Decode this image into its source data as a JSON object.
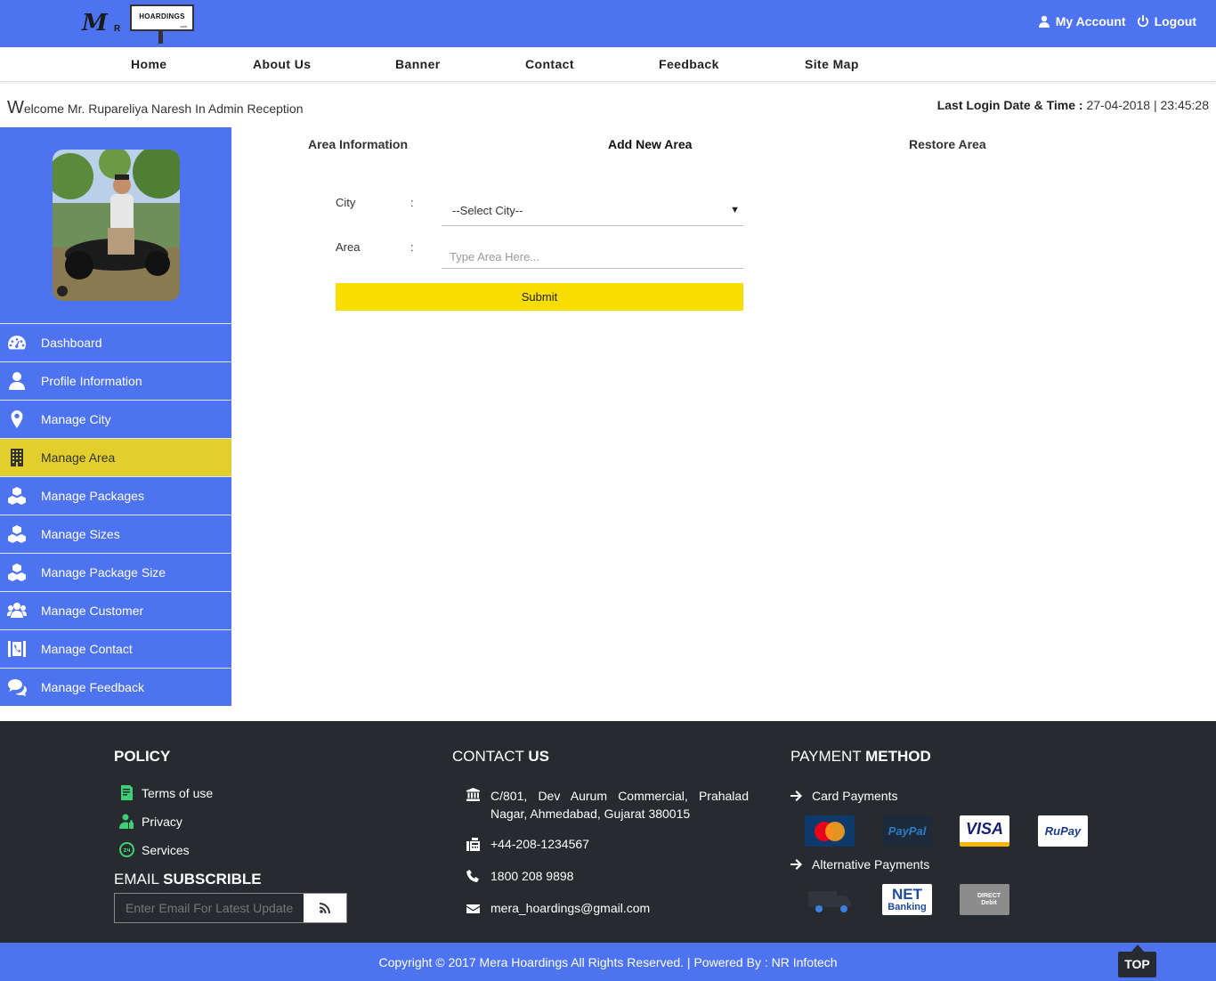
{
  "brand": {
    "logo_m": "M",
    "logo_r": "R",
    "logo_board": "HOARDINGS",
    "logo_board_small": "com"
  },
  "header": {
    "my_account": "My Account",
    "logout": "Logout"
  },
  "nav": [
    "Home",
    "About Us",
    "Banner",
    "Contact",
    "Feedback",
    "Site Map"
  ],
  "welcome": {
    "first_letter": "W",
    "rest": "elcome Mr. Rupareliya Naresh In Admin Reception"
  },
  "last_login": {
    "label": "Last Login Date & Time :",
    "value": "27-04-2018 | 23:45:28"
  },
  "sidebar": {
    "items": [
      {
        "label": "Dashboard",
        "icon": "dashboard-icon"
      },
      {
        "label": "Profile Information",
        "icon": "user-icon"
      },
      {
        "label": "Manage City",
        "icon": "map-marker-icon"
      },
      {
        "label": "Manage Area",
        "icon": "building-icon",
        "active": true
      },
      {
        "label": "Manage Packages",
        "icon": "cubes-icon"
      },
      {
        "label": "Manage Sizes",
        "icon": "cubes-icon"
      },
      {
        "label": "Manage Package Size",
        "icon": "cubes-icon"
      },
      {
        "label": "Manage Customer",
        "icon": "users-icon"
      },
      {
        "label": "Manage Contact",
        "icon": "contact-book-icon"
      },
      {
        "label": "Manage Feedback",
        "icon": "comments-icon"
      }
    ]
  },
  "tabs": [
    {
      "label": "Area Information"
    },
    {
      "label": "Add New Area",
      "active": true
    },
    {
      "label": "Restore Area"
    }
  ],
  "form": {
    "city_label": "City",
    "area_label": "Area",
    "colon": ":",
    "city_selected": "--Select City--",
    "area_placeholder": "Type Area Here...",
    "submit_label": "Submit"
  },
  "footer": {
    "policy_heading": "POLICY",
    "policy_links": [
      "Terms of use",
      "Privacy",
      "Services"
    ],
    "email_heading_light": "EMAIL",
    "email_heading_bold": "SUBSCRIBLE",
    "email_placeholder": "Enter Email For Latest Update",
    "contact_heading_light": "CONTACT",
    "contact_heading_bold": "US",
    "address": "C/801, Dev Aurum Commercial, Prahalad Nagar, Ahmedabad, Gujarat 380015",
    "fax": "+44-208-1234567",
    "phone": "1800 208 9898",
    "email": "mera_hoardings@gmail.com",
    "payment_heading_light": "PAYMENT",
    "payment_heading_bold": "METHOD",
    "card_payments": "Card Payments",
    "alternative_payments": "Alternative Payments",
    "cards": [
      "MasterCard",
      "PayPal",
      "VISA",
      "RuPay"
    ],
    "alternatives": [
      "NET",
      "Banking",
      "DIRECT",
      "Debit"
    ]
  },
  "copyright": "Copyright © 2017 Mera Hoardings All Rights Reserved. | Powered By : NR Infotech",
  "top_button": "TOP",
  "colors": {
    "primary": "#4d73f0",
    "active_menu": "#e2cf2e",
    "submit": "#f7de00",
    "footer": "#272b2f"
  }
}
